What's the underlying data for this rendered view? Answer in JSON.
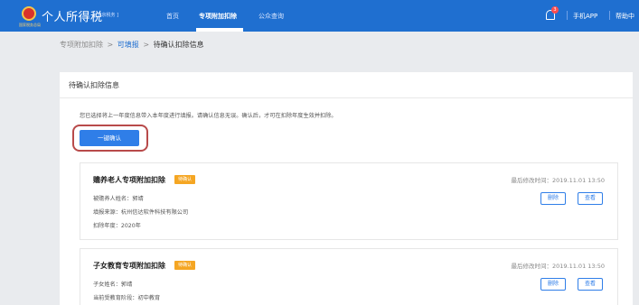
{
  "header": {
    "logo_text": "国家税务总局",
    "app_title": "个人所得税",
    "region": "[ 北京税务 ]",
    "nav": [
      "首页",
      "专项附加扣除",
      "公众查询"
    ],
    "notification_count": "3",
    "right_links": [
      "手机APP",
      "帮助中"
    ]
  },
  "breadcrumb": {
    "items": [
      "专项附加扣除",
      "可填报",
      "待确认扣除信息"
    ],
    "separator": ">"
  },
  "panel": {
    "title": "待确认扣除信息",
    "notice": "您已选择将上一年度信息带入本年度进行填报。请确认信息无误。确认后，才可在扣除年度生效并扣除。",
    "confirm_label": "一键确认"
  },
  "cards": [
    {
      "title": "赡养老人专项附加扣除",
      "status": "待确认",
      "time": "最后修改时间：2019.11.01 13:50",
      "lines": [
        "被赡养人姓名：郭靖",
        "填报来源：杭州信达软件科技有限公司",
        "扣除年度：2020年"
      ],
      "delete_label": "删除",
      "view_label": "查看"
    },
    {
      "title": "子女教育专项附加扣除",
      "status": "待确认",
      "time": "最后修改时间：2019.11.01 13:50",
      "lines": [
        "子女姓名：郭靖",
        "当前受教育阶段：初中教育"
      ],
      "delete_label": "删除",
      "view_label": "查看"
    }
  ]
}
